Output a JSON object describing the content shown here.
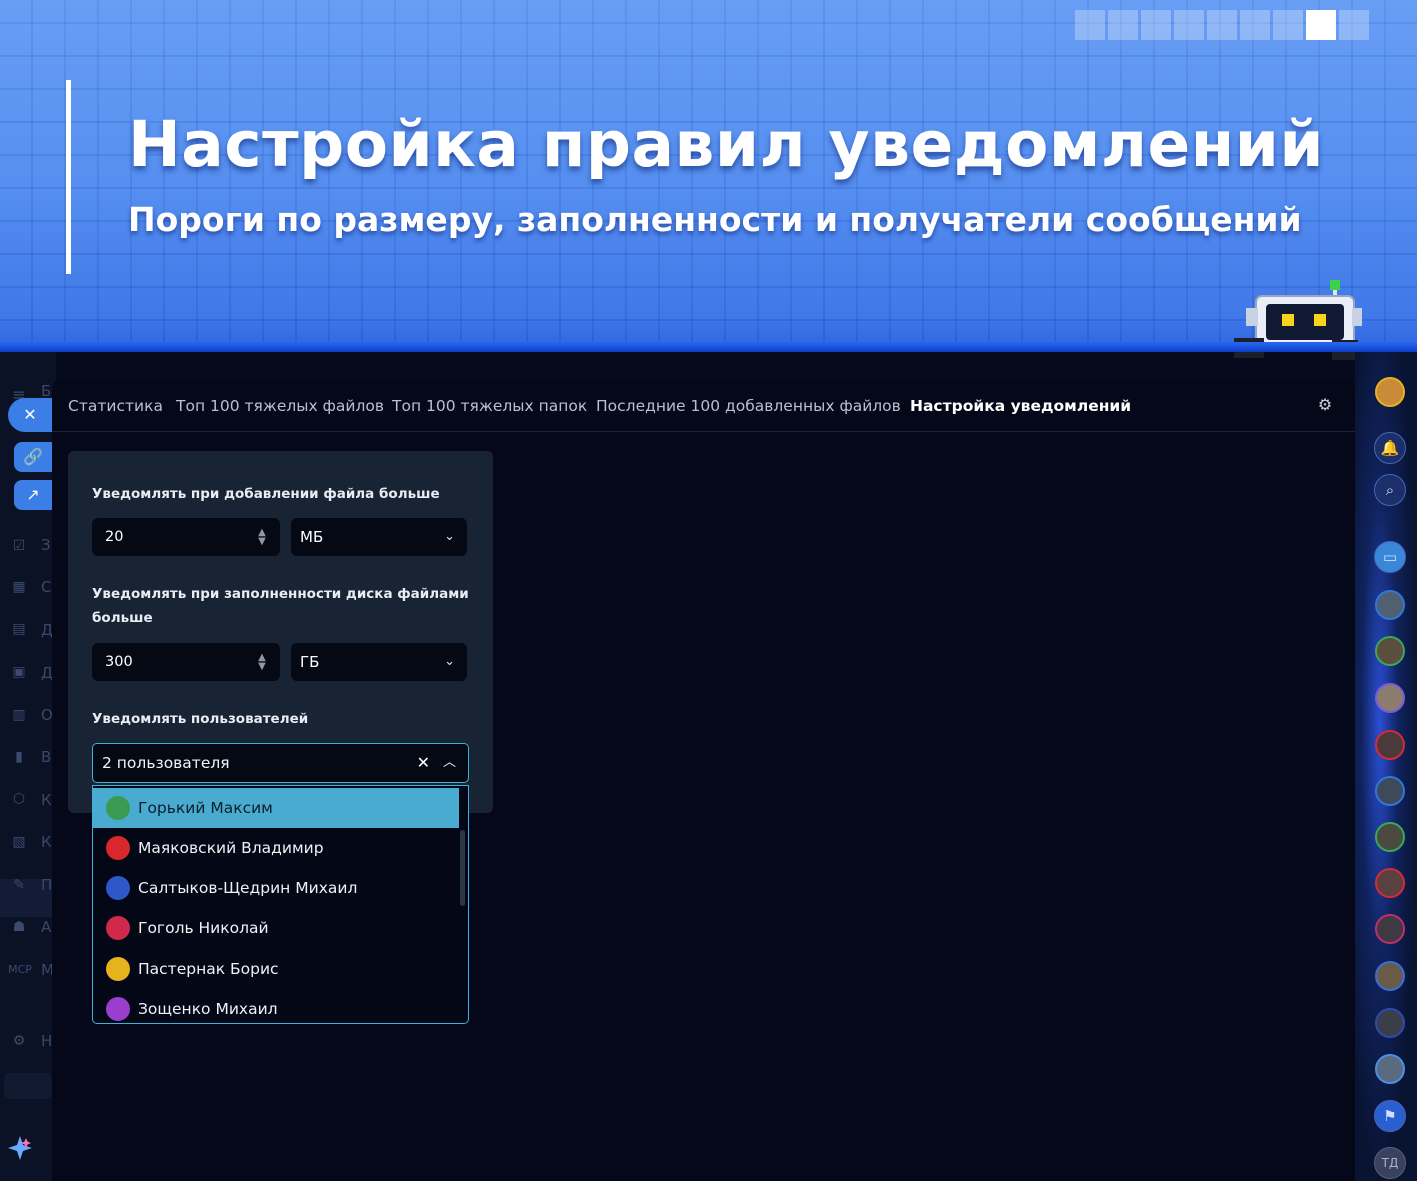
{
  "banner": {
    "title": "Настройка правил уведомлений",
    "subtitle": "Пороги по размеру, заполненности и получатели сообщений"
  },
  "tabs": [
    {
      "label": "Статистика",
      "active": false
    },
    {
      "label": "Топ 100 тяжелых файлов",
      "active": false
    },
    {
      "label": "Топ 100 тяжелых папок",
      "active": false
    },
    {
      "label": "Последние 100 добавленных файлов",
      "active": false
    },
    {
      "label": "Настройка уведомлений",
      "active": true
    }
  ],
  "form": {
    "file_size": {
      "label": "Уведомлять при добавлении файла больше",
      "value": "20",
      "unit": "МБ"
    },
    "disk_fill": {
      "label_line1": "Уведомлять при заполненности диска файлами",
      "label_line2": "больше",
      "value": "300",
      "unit": "ГБ"
    },
    "users": {
      "label": "Уведомлять пользователей",
      "selected_summary": "2 пользователя",
      "options": [
        {
          "name": "Горький Максим",
          "highlighted": true,
          "color": "#3a9a52"
        },
        {
          "name": "Маяковский Владимир",
          "highlighted": false,
          "color": "#d8282e"
        },
        {
          "name": "Салтыков-Щедрин Михаил",
          "highlighted": false,
          "color": "#2e58c8"
        },
        {
          "name": "Гоголь Николай",
          "highlighted": false,
          "color": "#d02a4a"
        },
        {
          "name": "Пастернак Борис",
          "highlighted": false,
          "color": "#e6b21e"
        },
        {
          "name": "Зощенко Михаил",
          "highlighted": false,
          "color": "#9a3ed0"
        }
      ]
    }
  },
  "left_rail": {
    "letters": [
      "Б",
      "З",
      "С",
      "Д",
      "Д",
      "О",
      "В",
      "К",
      "К",
      "П",
      "А",
      "М",
      "Н"
    ],
    "mcp_label": "MCP"
  },
  "right_rail": {
    "user_initials": "ТД"
  },
  "colors": {
    "accent": "#49abcf",
    "border_focus": "#3fb0d8",
    "panel_bg": "#040818",
    "card_bg": "#182334"
  }
}
